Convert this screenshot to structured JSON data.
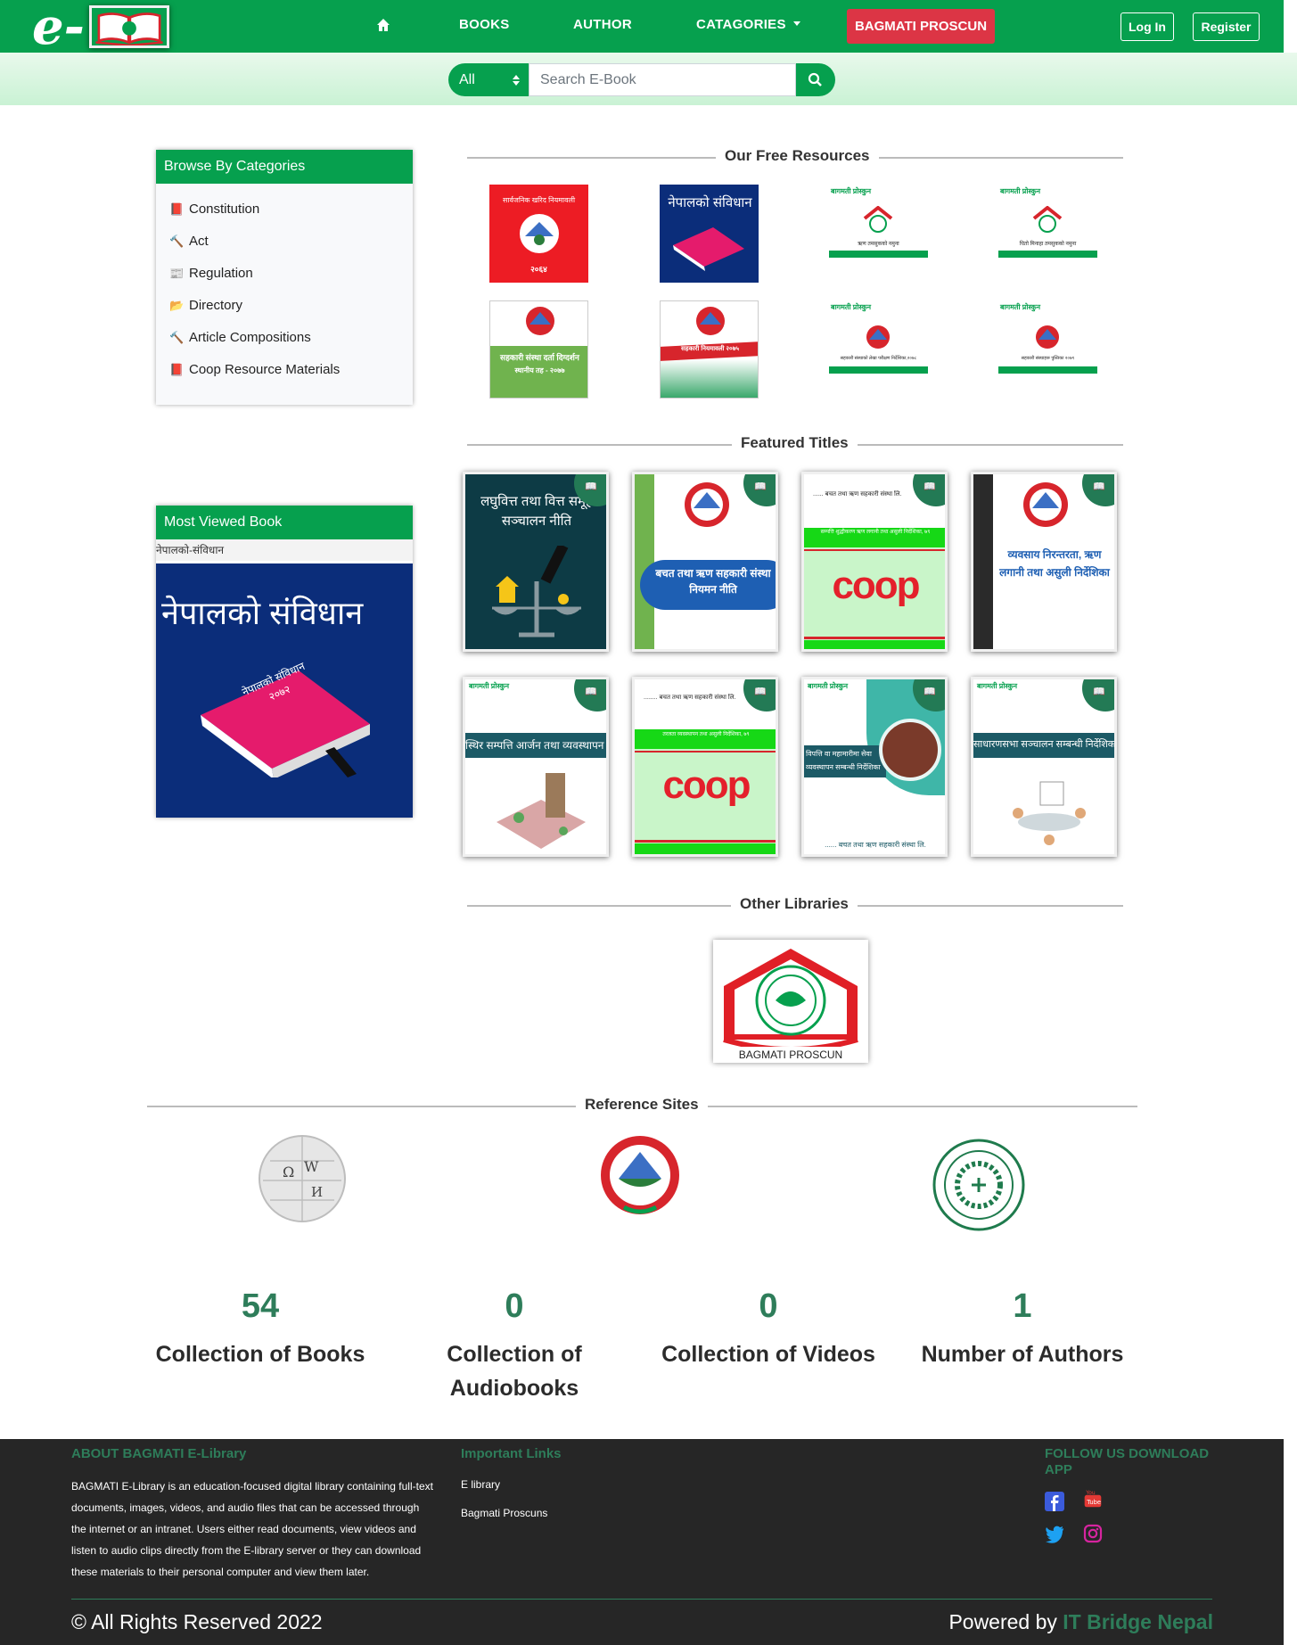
{
  "nav": {
    "logo_letter": "e-",
    "items": [
      {
        "label": "BOOKS"
      },
      {
        "label": "AUTHOR"
      },
      {
        "label": "CATAGORIES"
      }
    ],
    "highlight_label": "BAGMATI PROSCUN",
    "login_label": "Log In",
    "register_label": "Register"
  },
  "search": {
    "filter_value": "All",
    "placeholder": "Search E-Book"
  },
  "categories": {
    "title": "Browse By Categories",
    "items": [
      {
        "label": "Constitution",
        "icon": "book-icon"
      },
      {
        "label": "Act",
        "icon": "gavel-icon"
      },
      {
        "label": "Regulation",
        "icon": "newspaper-icon"
      },
      {
        "label": "Directory",
        "icon": "folder-open-icon"
      },
      {
        "label": "Article Compositions",
        "icon": "gavel-icon"
      },
      {
        "label": "Coop Resource Materials",
        "icon": "book-icon"
      }
    ]
  },
  "most_viewed": {
    "title": "Most Viewed Book",
    "book_title": "नेपालको-संविधान",
    "cover_text": "नेपालको संविधान",
    "cover_book_text": "नेपालको संविधान २०७२"
  },
  "free_resources": {
    "title": "Our Free Resources",
    "covers": [
      {
        "top": "सार्वजनिक खरिद नियमावली",
        "bottom": "२०६४",
        "color": "#ed1c24"
      },
      {
        "top": "नेपालको संविधान",
        "bottom": "",
        "color": "#0b2d7a"
      },
      {
        "top": "बागमती प्रोस्कुन",
        "bottom": "ऋण तमसुकको नमुना",
        "color": "#ffffff"
      },
      {
        "top": "बागमती प्रोस्कुन",
        "bottom": "धितो मिनाहा तमसुकको नमुना",
        "color": "#ffffff"
      },
      {
        "top": "सहकारी संस्था दर्ता दिग्दर्शन",
        "bottom": "स्थानीय तह - २०७७",
        "color": "#70b34e"
      },
      {
        "top": "सहकारी नियमावली २०७५",
        "bottom": "",
        "color": "#ffffff"
      },
      {
        "top": "बागमती प्रोस्कुन",
        "bottom": "सहकारी संस्थाको लेखा परीक्षण निर्देशिका,२०७८",
        "color": "#ffffff"
      },
      {
        "top": "बागमती प्रोस्कुन",
        "bottom": "सहकारी संस्थाहरू पुस्तिका २०७९",
        "color": "#ffffff"
      }
    ]
  },
  "featured": {
    "title": "Featured Titles",
    "books": [
      {
        "title": "लघुवित्त तथा वित्त समूह सञ्चालन नीति"
      },
      {
        "title": "बचत तथा ऋण सहकारी संस्था नियमन नीति"
      },
      {
        "title": "coop",
        "subtitle": "सम्पत्ति शुद्धीकरण ऋण लगानी तथा असुली निर्देशिका, ७९",
        "header": "...... बचत तथा ऋण सहकारी संस्था लि."
      },
      {
        "title": "व्यवसाय निरन्तरता, ऋण लगानी तथा असुली निर्देशिका"
      },
      {
        "title": "स्थिर सम्पत्ति आर्जन तथा व्यवस्थापन नीति"
      },
      {
        "title": "coop",
        "subtitle": "तरलता व्यवस्थापन तथा असुली निर्देशिका, ७९",
        "header": "........ बचत तथा ऋण सहकारी संस्था लि."
      },
      {
        "title": "विपत्ति वा महामारीमा सेवा व्यवस्थापन सम्बन्धी निर्देशिका",
        "footer": "...... बचत तथा ऋण सहकारी संस्था लि."
      },
      {
        "title": "साधारणसभा सञ्चालन सम्बन्धी निर्देशिका"
      }
    ]
  },
  "other_libraries": {
    "title": "Other Libraries",
    "items": [
      {
        "label": "BAGMATI PROSCUN"
      }
    ]
  },
  "reference": {
    "title": "Reference Sites"
  },
  "stats": [
    {
      "value": "54",
      "label": "Collection of Books"
    },
    {
      "value": "0",
      "label": "Collection of Audiobooks"
    },
    {
      "value": "0",
      "label": "Collection of Videos"
    },
    {
      "value": "1",
      "label": "Number of Authors"
    }
  ],
  "footer": {
    "about_title": "ABOUT BAGMATI E-Library",
    "about_text": "BAGMATI E-Library is an education-focused digital library containing full-text documents, images, videos, and audio files that can be accessed through the internet or an intranet. Users either read documents, view videos and listen to audio clips directly from the E-library server or they can download these materials to their personal computer and view them later.",
    "links_title": "Important Links",
    "links": [
      {
        "label": "E library"
      },
      {
        "label": "Bagmati Proscuns"
      }
    ],
    "follow_title": "FOLLOW US DOWNLOAD APP",
    "copyright": "© All Rights Reserved 2022",
    "powered_prefix": "Powered by ",
    "powered_brand": "IT Bridge Nepal",
    "colors": {
      "accent": "#2e7d5a",
      "bg": "#262626"
    }
  },
  "colors": {
    "primary": "#06a04e",
    "danger": "#dc3545"
  }
}
